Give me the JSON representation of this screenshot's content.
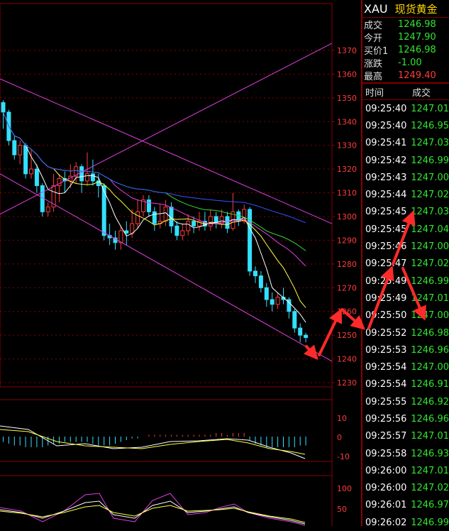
{
  "header": {
    "symbol": "XAU",
    "name": "现货黄金",
    "rows": [
      {
        "label": "成交",
        "value": "1246.98",
        "color": "green"
      },
      {
        "label": "今开",
        "value": "1247.90",
        "color": "green"
      },
      {
        "label": "买价1",
        "value": "1246.98",
        "color": "green"
      },
      {
        "label": "涨跌",
        "value": "-1.00",
        "color": "green"
      },
      {
        "label": "最高",
        "value": "1249.40",
        "color": "red"
      }
    ]
  },
  "ticks": {
    "col_time": "时间",
    "col_price": "成交",
    "rows": [
      {
        "time": "09:25:40",
        "price": "1247.01"
      },
      {
        "time": "09:25:40",
        "price": "1246.95"
      },
      {
        "time": "09:25:41",
        "price": "1247.03"
      },
      {
        "time": "09:25:42",
        "price": "1246.99"
      },
      {
        "time": "09:25:43",
        "price": "1247.00"
      },
      {
        "time": "09:25:44",
        "price": "1247.02"
      },
      {
        "time": "09:25:45",
        "price": "1247.03"
      },
      {
        "time": "09:25:45",
        "price": "1247.04"
      },
      {
        "time": "09:25:46",
        "price": "1247.00"
      },
      {
        "time": "09:25:47",
        "price": "1247.02"
      },
      {
        "time": "09:25:49",
        "price": "1246.99"
      },
      {
        "time": "09:25:49",
        "price": "1247.01"
      },
      {
        "time": "09:25:50",
        "price": "1247.00"
      },
      {
        "time": "09:25:52",
        "price": "1246.98"
      },
      {
        "time": "09:25:53",
        "price": "1246.96"
      },
      {
        "time": "09:25:54",
        "price": "1247.00"
      },
      {
        "time": "09:25:54",
        "price": "1246.91"
      },
      {
        "time": "09:25:55",
        "price": "1246.92"
      },
      {
        "time": "09:25:56",
        "price": "1246.96"
      },
      {
        "time": "09:25:57",
        "price": "1247.01"
      },
      {
        "time": "09:25:58",
        "price": "1246.93"
      },
      {
        "time": "09:26:00",
        "price": "1247.01"
      },
      {
        "time": "09:26:00",
        "price": "1247.02"
      },
      {
        "time": "09:26:01",
        "price": "1246.97"
      },
      {
        "time": "09:26:02",
        "price": "1246.99"
      }
    ]
  },
  "main_axis": [
    "1370",
    "1360",
    "1350",
    "1340",
    "1330",
    "1320",
    "1310",
    "1300",
    "1290",
    "1280",
    "1270",
    "1260",
    "1250",
    "1240",
    "1230"
  ],
  "macd_axis": [
    "10",
    "0",
    "-10"
  ],
  "kdj_axis": [
    "100",
    "50"
  ],
  "colors": {
    "grid": "#8a0000",
    "up": "#ff3b3b",
    "down": "#33e0ff",
    "price_green": "#2ee62e",
    "channel": "#e040e0",
    "arrow": "#ff2a2a"
  },
  "candles": [
    [
      1348,
      1344,
      1349,
      1337
    ],
    [
      1344,
      1332,
      1345,
      1330
    ],
    [
      1332,
      1326,
      1334,
      1324
    ],
    [
      1326,
      1330,
      1332,
      1322
    ],
    [
      1330,
      1318,
      1331,
      1316
    ],
    [
      1318,
      1320,
      1328,
      1316
    ],
    [
      1320,
      1313,
      1322,
      1310
    ],
    [
      1313,
      1302,
      1314,
      1300
    ],
    [
      1302,
      1304,
      1306,
      1300
    ],
    [
      1304,
      1313,
      1318,
      1302
    ],
    [
      1313,
      1316,
      1318,
      1306
    ],
    [
      1316,
      1315,
      1319,
      1310
    ],
    [
      1315,
      1317,
      1322,
      1312
    ],
    [
      1317,
      1321,
      1323,
      1314
    ],
    [
      1321,
      1315,
      1322,
      1310
    ],
    [
      1315,
      1318,
      1327,
      1313
    ],
    [
      1318,
      1315,
      1324,
      1313
    ],
    [
      1315,
      1313,
      1318,
      1308
    ],
    [
      1313,
      1292,
      1314,
      1290
    ],
    [
      1292,
      1291,
      1297,
      1288
    ],
    [
      1291,
      1289,
      1294,
      1286
    ],
    [
      1289,
      1294,
      1296,
      1286
    ],
    [
      1294,
      1293,
      1298,
      1288
    ],
    [
      1293,
      1297,
      1303,
      1291
    ],
    [
      1297,
      1302,
      1307,
      1295
    ],
    [
      1302,
      1307,
      1309,
      1300
    ],
    [
      1307,
      1302,
      1309,
      1300
    ],
    [
      1302,
      1297,
      1304,
      1294
    ],
    [
      1297,
      1298,
      1305,
      1295
    ],
    [
      1298,
      1304,
      1307,
      1296
    ],
    [
      1304,
      1296,
      1306,
      1293
    ],
    [
      1296,
      1292,
      1298,
      1290
    ],
    [
      1292,
      1294,
      1297,
      1290
    ],
    [
      1294,
      1298,
      1301,
      1292
    ],
    [
      1298,
      1296,
      1300,
      1293
    ],
    [
      1296,
      1298,
      1302,
      1294
    ],
    [
      1298,
      1296,
      1302,
      1294
    ],
    [
      1296,
      1300,
      1303,
      1294
    ],
    [
      1300,
      1297,
      1302,
      1295
    ],
    [
      1297,
      1300,
      1303,
      1295
    ],
    [
      1300,
      1295,
      1302,
      1293
    ],
    [
      1295,
      1302,
      1310,
      1294
    ],
    [
      1302,
      1298,
      1303,
      1296
    ],
    [
      1298,
      1303,
      1305,
      1297
    ],
    [
      1303,
      1277,
      1304,
      1275
    ],
    [
      1277,
      1275,
      1279,
      1272
    ],
    [
      1275,
      1270,
      1277,
      1268
    ],
    [
      1270,
      1265,
      1272,
      1262
    ],
    [
      1265,
      1263,
      1268,
      1260
    ],
    [
      1263,
      1266,
      1268,
      1261
    ],
    [
      1266,
      1265,
      1270,
      1263
    ],
    [
      1265,
      1260,
      1266,
      1257
    ],
    [
      1260,
      1253,
      1261,
      1251
    ],
    [
      1253,
      1250,
      1255,
      1247
    ],
    [
      1250,
      1249,
      1251,
      1247
    ]
  ],
  "macd_bars": [
    -3,
    -4,
    -5,
    -5,
    -6,
    -6,
    -6,
    -6,
    -5,
    -4,
    -4,
    -3,
    -3,
    -3,
    -3,
    -3,
    -4,
    -5,
    -5,
    -5,
    -4,
    -3,
    -2,
    -1,
    -1,
    0,
    1,
    1,
    1,
    1,
    1,
    1,
    1,
    1,
    1,
    1,
    1,
    1,
    2,
    2,
    1,
    2,
    2,
    2,
    -2,
    -4,
    -5,
    -6,
    -6,
    -6,
    -6,
    -6,
    -6,
    -5,
    -5
  ]
}
